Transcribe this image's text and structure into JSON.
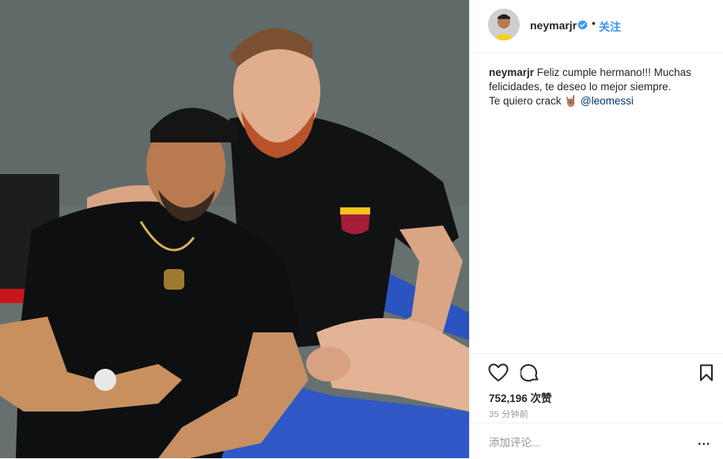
{
  "post": {
    "image_description_icon": "photo-of-two-men",
    "author": "neymarjr",
    "verified": true,
    "follow_label": "关注",
    "separator": "•",
    "caption_user": "neymarjr",
    "caption_line1": " Feliz cumple hermano!!! Muchas felicidades, te deseo lo mejor siempre.",
    "caption_line2": "Te quiero crack ",
    "caption_emoji": "🤘🏽",
    "caption_mention": "@leomessi",
    "likes": "752,196 次赞",
    "time": "35 分钟前",
    "comment_placeholder": "添加评论...",
    "more_label": "..."
  },
  "icons": {
    "like": "heart-icon",
    "comment": "comment-bubble-icon",
    "save": "bookmark-icon",
    "verified": "verified-badge-icon"
  },
  "colors": {
    "link": "#3897f0",
    "verified": "#3897f0",
    "mention": "#003569",
    "muted": "#999999"
  }
}
